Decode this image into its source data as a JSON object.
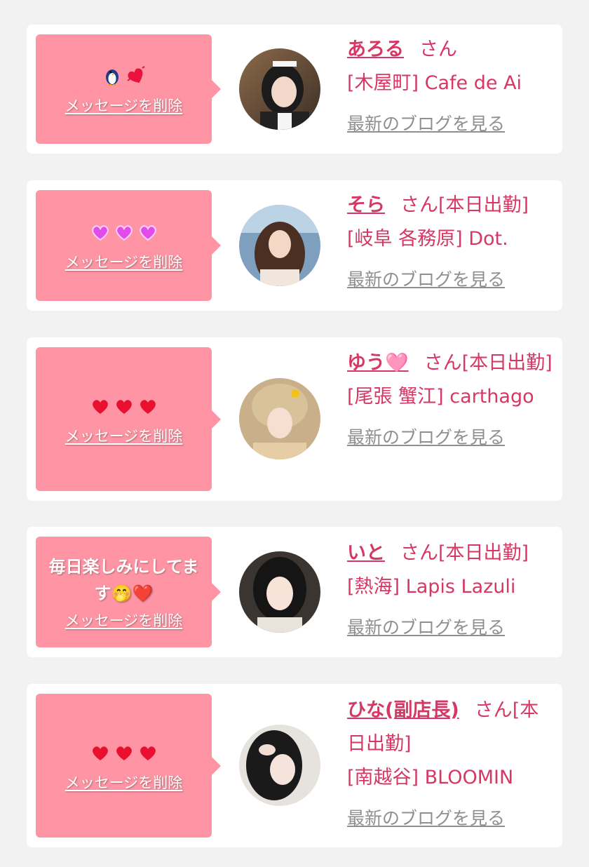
{
  "cards": [
    {
      "message": "",
      "emoji": [
        "penguin",
        "dancing-heart"
      ],
      "delete_label": "メッセージを削除",
      "name": "あろる",
      "honorific": "さん",
      "status": "",
      "shop": "[木屋町] Cafe de Ai",
      "blog_label": "最新のブログを見る"
    },
    {
      "message": "",
      "emoji": [
        "purple-heart",
        "purple-heart",
        "purple-heart"
      ],
      "delete_label": "メッセージを削除",
      "name": "そら",
      "honorific": "さん",
      "status": "[本日出勤]",
      "shop": "[岐阜 各務原] Dot.",
      "blog_label": "最新のブログを見る"
    },
    {
      "message": "",
      "emoji": [
        "red-heart",
        "red-heart",
        "red-heart"
      ],
      "delete_label": "メッセージを削除",
      "name": "ゆう🩷",
      "honorific": "さん",
      "status": "[本日出勤]",
      "shop": "[尾張 蟹江] carthago",
      "blog_label": "最新のブログを見る"
    },
    {
      "message": "毎日楽しみにしてます🤭❤️",
      "emoji": [],
      "delete_label": "メッセージを削除",
      "name": "いと",
      "honorific": "さん",
      "status": "[本日出勤]",
      "shop": "[熱海] Lapis Lazuli",
      "blog_label": "最新のブログを見る"
    },
    {
      "message": "",
      "emoji": [
        "red-heart",
        "red-heart",
        "red-heart"
      ],
      "delete_label": "メッセージを削除",
      "name": "ひな(副店長)",
      "honorific": "さん",
      "status": "[本日出勤]",
      "shop": "[南越谷] BLOOMIN",
      "blog_label": "最新のブログを見る"
    }
  ],
  "colors": {
    "accent": "#d63765",
    "bubble": "#ff95a4",
    "link_gray": "#8f8f8f",
    "background": "#f2f2f2"
  }
}
